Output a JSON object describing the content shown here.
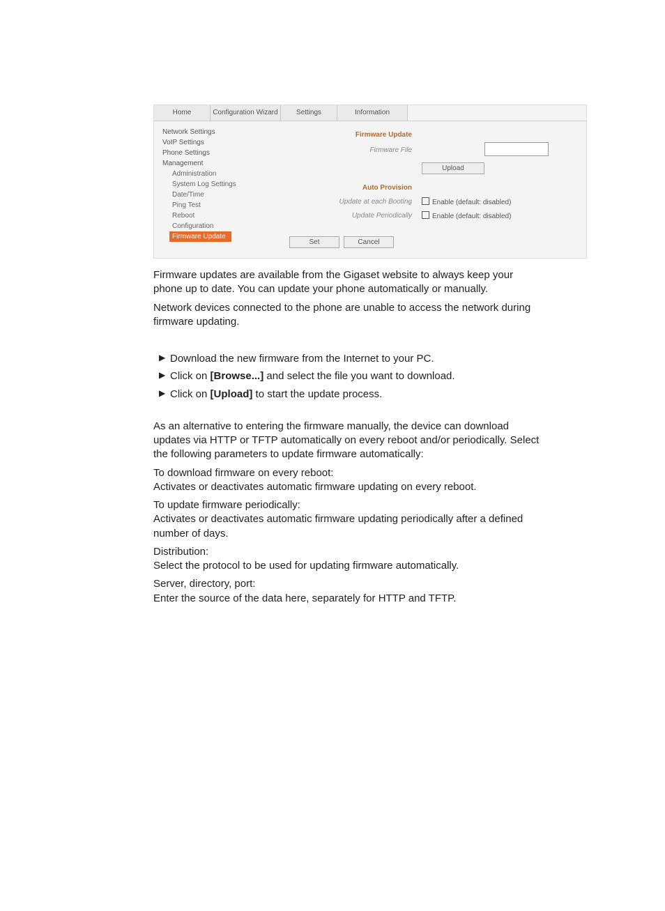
{
  "ui": {
    "tabs": [
      "Home",
      "Configuration Wizard",
      "Settings",
      "Information"
    ],
    "sidebar": {
      "groups": [
        "Network Settings",
        "VoIP Settings",
        "Phone Settings",
        "Management"
      ],
      "subs": [
        "Administration",
        "System Log Settings",
        "Date/Time",
        "Ping Test",
        "Reboot",
        "Configuration"
      ],
      "active": "Firmware Update"
    },
    "sections": {
      "firmware_update": "Firmware Update",
      "firmware_file": "Firmware File",
      "upload": "Upload",
      "auto_provision": "Auto Provision",
      "update_boot": "Update at each Booting",
      "update_periodic": "Update Periodically",
      "enable_text": "Enable (default: disabled)",
      "set": "Set",
      "cancel": "Cancel"
    }
  },
  "body": {
    "p1": "Firmware updates are available from the Gigaset website to always keep your phone up to date. You can update your phone automatically or manually.",
    "p2": "Network devices connected to the phone are unable to access the network during firmware updating.",
    "step1": "Download the new firmware from the Internet to your PC.",
    "step2a": "Click on ",
    "step2b": "[Browse...]",
    "step2c": " and select the file you want to download.",
    "step3a": "Click on ",
    "step3b": "[Upload]",
    "step3c": " to start the update process.",
    "alt": "As an alternative to entering the firmware manually, the device can download updates via HTTP or TFTP automatically on every reboot and/or periodically. Select the following parameters to update firmware automatically:",
    "dl_reboot_t": "To download firmware on every reboot:",
    "dl_reboot_d": "Activates or deactivates automatic firmware updating on every reboot.",
    "up_period_t": "To update firmware periodically:",
    "up_period_d": "Activates or deactivates automatic firmware updating periodically after a defined number of days.",
    "dist_t": "Distribution:",
    "dist_d": "Select the protocol to be used for updating firmware automatically.",
    "srv_t": "Server, directory, port:",
    "srv_d": "Enter the source of the data here, separately for HTTP and TFTP."
  }
}
